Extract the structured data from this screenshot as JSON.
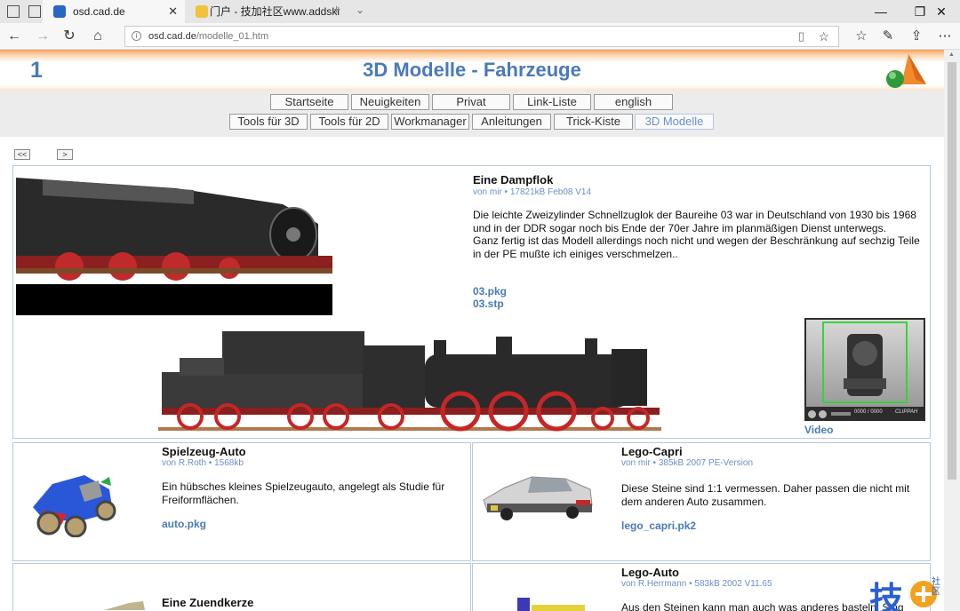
{
  "browser": {
    "tabs": [
      {
        "title": "osd.cad.de",
        "active": true
      },
      {
        "title": "门户 - 技加社区www.addski",
        "active": false
      }
    ],
    "url_host": "osd.cad.de",
    "url_path": "/modelle_01.htm"
  },
  "page": {
    "number": "1",
    "title": "3D Modelle - Fahrzeuge"
  },
  "nav": {
    "row1": [
      "Startseite",
      "Neuigkeiten",
      "Privat",
      "Link-Liste",
      "english"
    ],
    "row2": [
      "Tools für 3D",
      "Tools für 2D",
      "Workmanager",
      "Anleitungen",
      "Trick-Kiste",
      "3D Modelle"
    ],
    "current": "3D Modelle"
  },
  "pager": {
    "prev": "<<",
    "next": ">"
  },
  "items": {
    "dampflok": {
      "title": "Eine Dampflok",
      "meta": "von mir • 17821kB Feb08 V14",
      "desc1": "Die leichte Zweizylinder Schnellzuglok der Baureihe 03 war in Deutschland von 1930 bis 1968 und in der DDR sogar noch bis Ende der 70er Jahre im planmäßigen Dienst unterwegs.",
      "desc2": "Ganz fertig ist das Modell allerdings noch nicht und wegen der Beschränkung auf sechzig Teile in der PE mußte ich einiges verschmelzen..",
      "link1": "03.pkg",
      "link2": "03.stp",
      "video_label": "Video",
      "player_time": "0000 / 0000",
      "player_brand": "CLIPPAH"
    },
    "spielzeug": {
      "title": "Spielzeug-Auto",
      "meta": "von R.Roth • 1568kb",
      "desc": "Ein hübsches kleines Spielzeugauto, angelegt als Studie für Freiformflächen.",
      "link": "auto.pkg"
    },
    "capri": {
      "title": "Lego-Capri",
      "meta": "von mir • 385kB 2007 PE-Version",
      "desc": "Diese Steine sind 1:1 vermessen. Daher passen die nicht mit dem anderen Auto zusammen.",
      "link": "lego_capri.pk2"
    },
    "zuendkerze": {
      "title": "Eine Zuendkerze"
    },
    "legoauto": {
      "title": "Lego-Auto",
      "meta": "von R.Herrmann • 583kB 2002 V11.65",
      "desc": "Aus den Steinen kann man auch was anderes basteln. Sing"
    }
  },
  "watermark": {
    "char": "技",
    "small": "社区"
  },
  "colors": {
    "accent": "#4a7ab8",
    "header_orange": "#f5a05a",
    "border": "#b8c8dc"
  }
}
